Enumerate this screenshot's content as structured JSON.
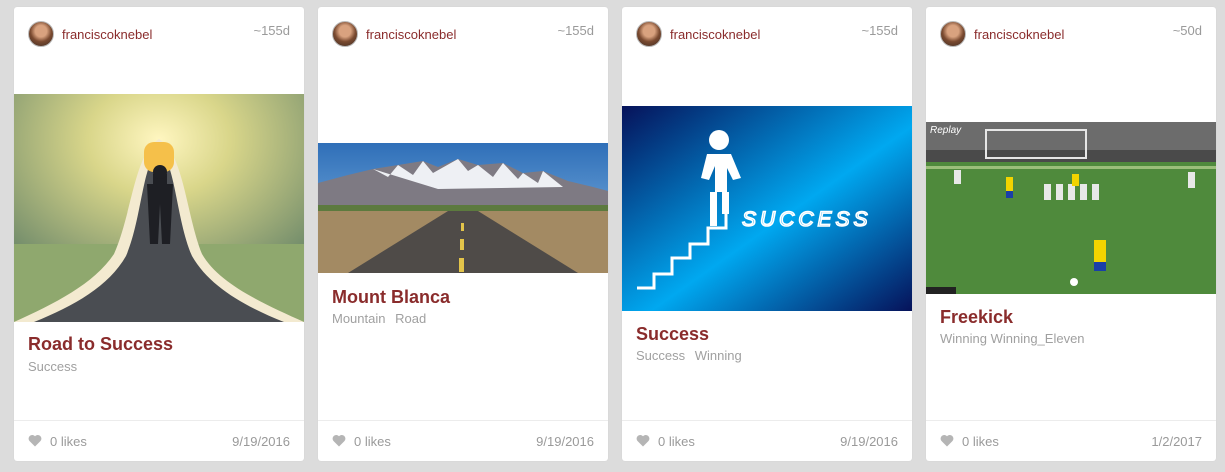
{
  "cards": [
    {
      "author": "franciscoknebel",
      "age": "~155d",
      "title": "Road to Success",
      "tags": [
        "Success"
      ],
      "likes": "0 likes",
      "date": "9/19/2016",
      "image": "road-to-success-photo"
    },
    {
      "author": "franciscoknebel",
      "age": "~155d",
      "title": "Mount Blanca",
      "tags": [
        "Mountain",
        "Road"
      ],
      "likes": "0 likes",
      "date": "9/19/2016",
      "image": "mountain-road-photo"
    },
    {
      "author": "franciscoknebel",
      "age": "~155d",
      "title": "Success",
      "tags": [
        "Success",
        "Winning"
      ],
      "likes": "0 likes",
      "date": "9/19/2016",
      "image": "success-stairs-graphic",
      "image_text": "SUCCESS"
    },
    {
      "author": "franciscoknebel",
      "age": "~50d",
      "title": "Freekick",
      "tags": [
        "Winning Winning_Eleven"
      ],
      "likes": "0 likes",
      "date": "1/2/2017",
      "image": "soccer-game-screenshot",
      "image_text": "Replay"
    }
  ],
  "colors": {
    "accent": "#8a2c2c",
    "muted": "#9a9a9a",
    "background": "#dcdcdc"
  },
  "icons": {
    "like": "heart-icon",
    "avatar": "avatar"
  }
}
